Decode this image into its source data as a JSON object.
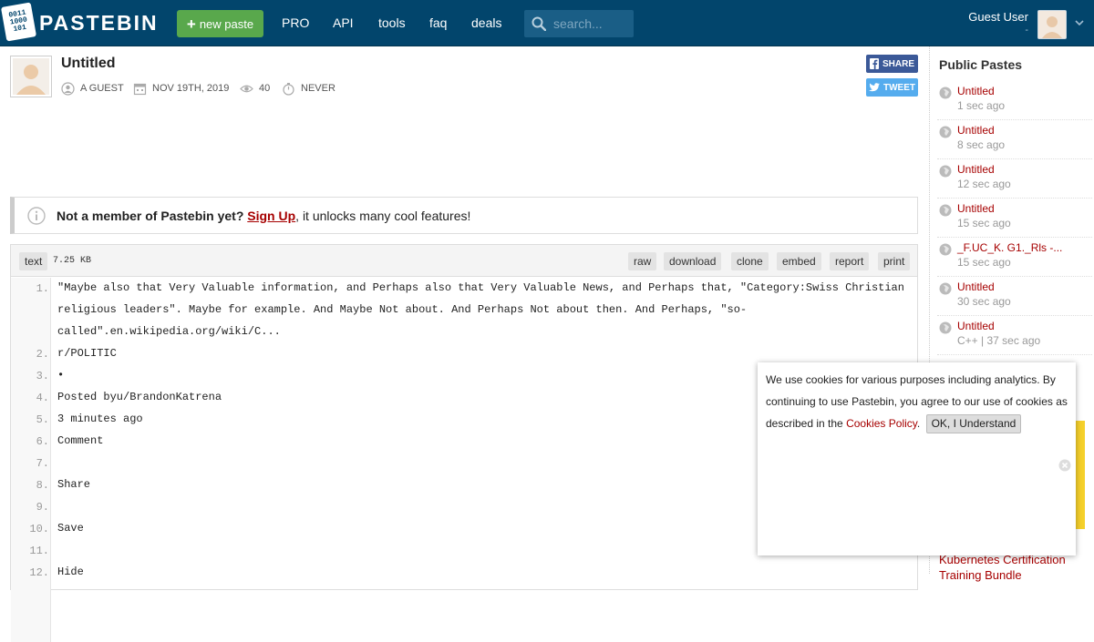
{
  "header": {
    "logo_digits": [
      "0011",
      "1000",
      "101"
    ],
    "brand": "PASTEBIN",
    "new_paste_label": "new paste",
    "nav": [
      "PRO",
      "API",
      "tools",
      "faq",
      "deals"
    ],
    "search_placeholder": "search...",
    "user_name": "Guest User",
    "user_sub": "-"
  },
  "paste": {
    "title": "Untitled",
    "author": "A GUEST",
    "date": "NOV 19TH, 2019",
    "views": "40",
    "expires": "NEVER",
    "share_label": "SHARE",
    "tweet_label": "TWEET"
  },
  "notice": {
    "lead": "Not a member of Pastebin yet?",
    "link": "Sign Up",
    "tail": ", it unlocks many cool features!"
  },
  "code": {
    "language": "text",
    "size": "7.25 KB",
    "actions": [
      "raw",
      "download",
      "clone",
      "embed",
      "report",
      "print"
    ],
    "lines": [
      "\"Maybe also that Very Valuable information, and Perhaps also that Very Valuable News, and Perhaps that, \"Category:Swiss Christian religious leaders\". Maybe for example. And Maybe Not about. And Perhaps Not about then. And Perhaps, \"so-called\".en.wikipedia.org/wiki/C...",
      "r/POLITIC",
      "•",
      "Posted byu/BrandonKatrena",
      "3 minutes ago",
      "Comment",
      "",
      "Share",
      "",
      "Save",
      "",
      "Hide"
    ]
  },
  "sidebar": {
    "title": "Public Pastes",
    "items": [
      {
        "name": "Untitled",
        "time": "1 sec ago"
      },
      {
        "name": "Untitled",
        "time": "8 sec ago"
      },
      {
        "name": "Untitled",
        "time": "12 sec ago"
      },
      {
        "name": "Untitled",
        "time": "15 sec ago"
      },
      {
        "name": "_F.UC_K. G1._Rls -...",
        "time": "15 sec ago"
      },
      {
        "name": "Untitled",
        "time": "30 sec ago"
      },
      {
        "name": "Untitled",
        "time": "C++ | 37 sec ago"
      }
    ],
    "ad_link": "Kubernetes Certification Training Bundle"
  },
  "cookie": {
    "text": "We use cookies for various purposes including analytics. By continuing to use Pastebin, you agree to our use of cookies as described in the",
    "link": "Cookies Policy",
    "after": ".",
    "ok_label": "OK, I Understand"
  },
  "colors": {
    "header_bg": "#02456c",
    "new_paste_bg": "#59a84c",
    "link_red": "#a60000",
    "share_bg": "#3b5998",
    "tweet_bg": "#55acee"
  }
}
